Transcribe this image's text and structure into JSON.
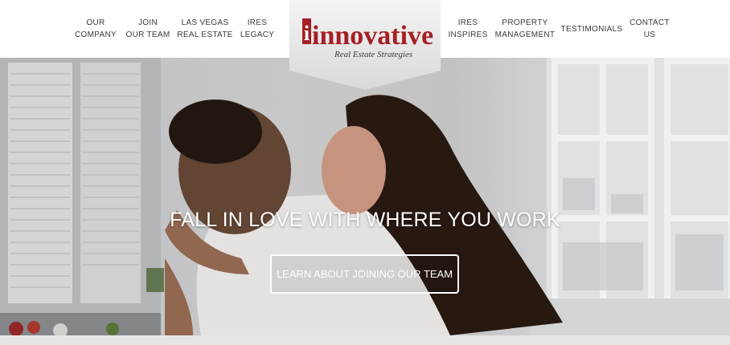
{
  "nav": {
    "left_items": [
      {
        "line1": "OUR",
        "line2": "COMPANY"
      },
      {
        "line1": "JOIN",
        "line2": "OUR TEAM"
      },
      {
        "line1": "LAS VEGAS",
        "line2": "REAL ESTATE"
      },
      {
        "line1": "IRES",
        "line2": "LEGACY"
      }
    ],
    "right_items": [
      {
        "line1": "IRES",
        "line2": "INSPIRES"
      },
      {
        "line1": "PROPERTY",
        "line2": "MANAGEMENT"
      },
      {
        "line1": "TESTIMONIALS",
        "line2": ""
      },
      {
        "line1": "CONTACT",
        "line2": "US"
      }
    ]
  },
  "logo": {
    "wordmark": "innovative",
    "tagline": "Real Estate Strategies",
    "colors": {
      "wordmark": "#a51f24",
      "initial_box": "#a51f24",
      "tagline": "#3b3b3b"
    }
  },
  "hero": {
    "heading": "FALL IN LOVE WITH WHERE YOU WORK",
    "cta_label": "LEARN ABOUT JOINING OUR TEAM"
  },
  "colors": {
    "nav_text": "#3a3a3a",
    "hero_text": "#ffffff",
    "strip": "#e7e5e4"
  }
}
